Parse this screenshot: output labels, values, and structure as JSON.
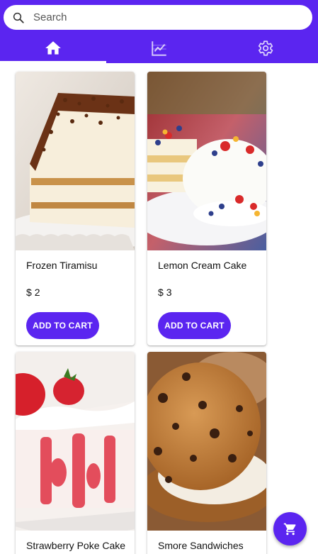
{
  "search": {
    "placeholder": "Search",
    "value": ""
  },
  "tabs": [
    {
      "icon": "home-icon",
      "active": true
    },
    {
      "icon": "chart-icon",
      "active": false
    },
    {
      "icon": "gear-icon",
      "active": false
    }
  ],
  "colors": {
    "accent": "#5b25f0",
    "background": "#ffffff"
  },
  "products": [
    {
      "name": "Frozen Tiramisu",
      "currency": "$",
      "price": "2",
      "button": "ADD TO CART",
      "image": "tiramisu-photo"
    },
    {
      "name": "Lemon Cream Cake",
      "currency": "$",
      "price": "3",
      "button": "ADD TO CART",
      "image": "lemon-cream-cake-photo"
    },
    {
      "name": "Strawberry Poke Cake",
      "image": "strawberry-poke-cake-photo"
    },
    {
      "name": "Smore Sandwiches",
      "image": "smore-sandwich-photo"
    }
  ],
  "cart_fab": {
    "icon": "cart-icon"
  }
}
